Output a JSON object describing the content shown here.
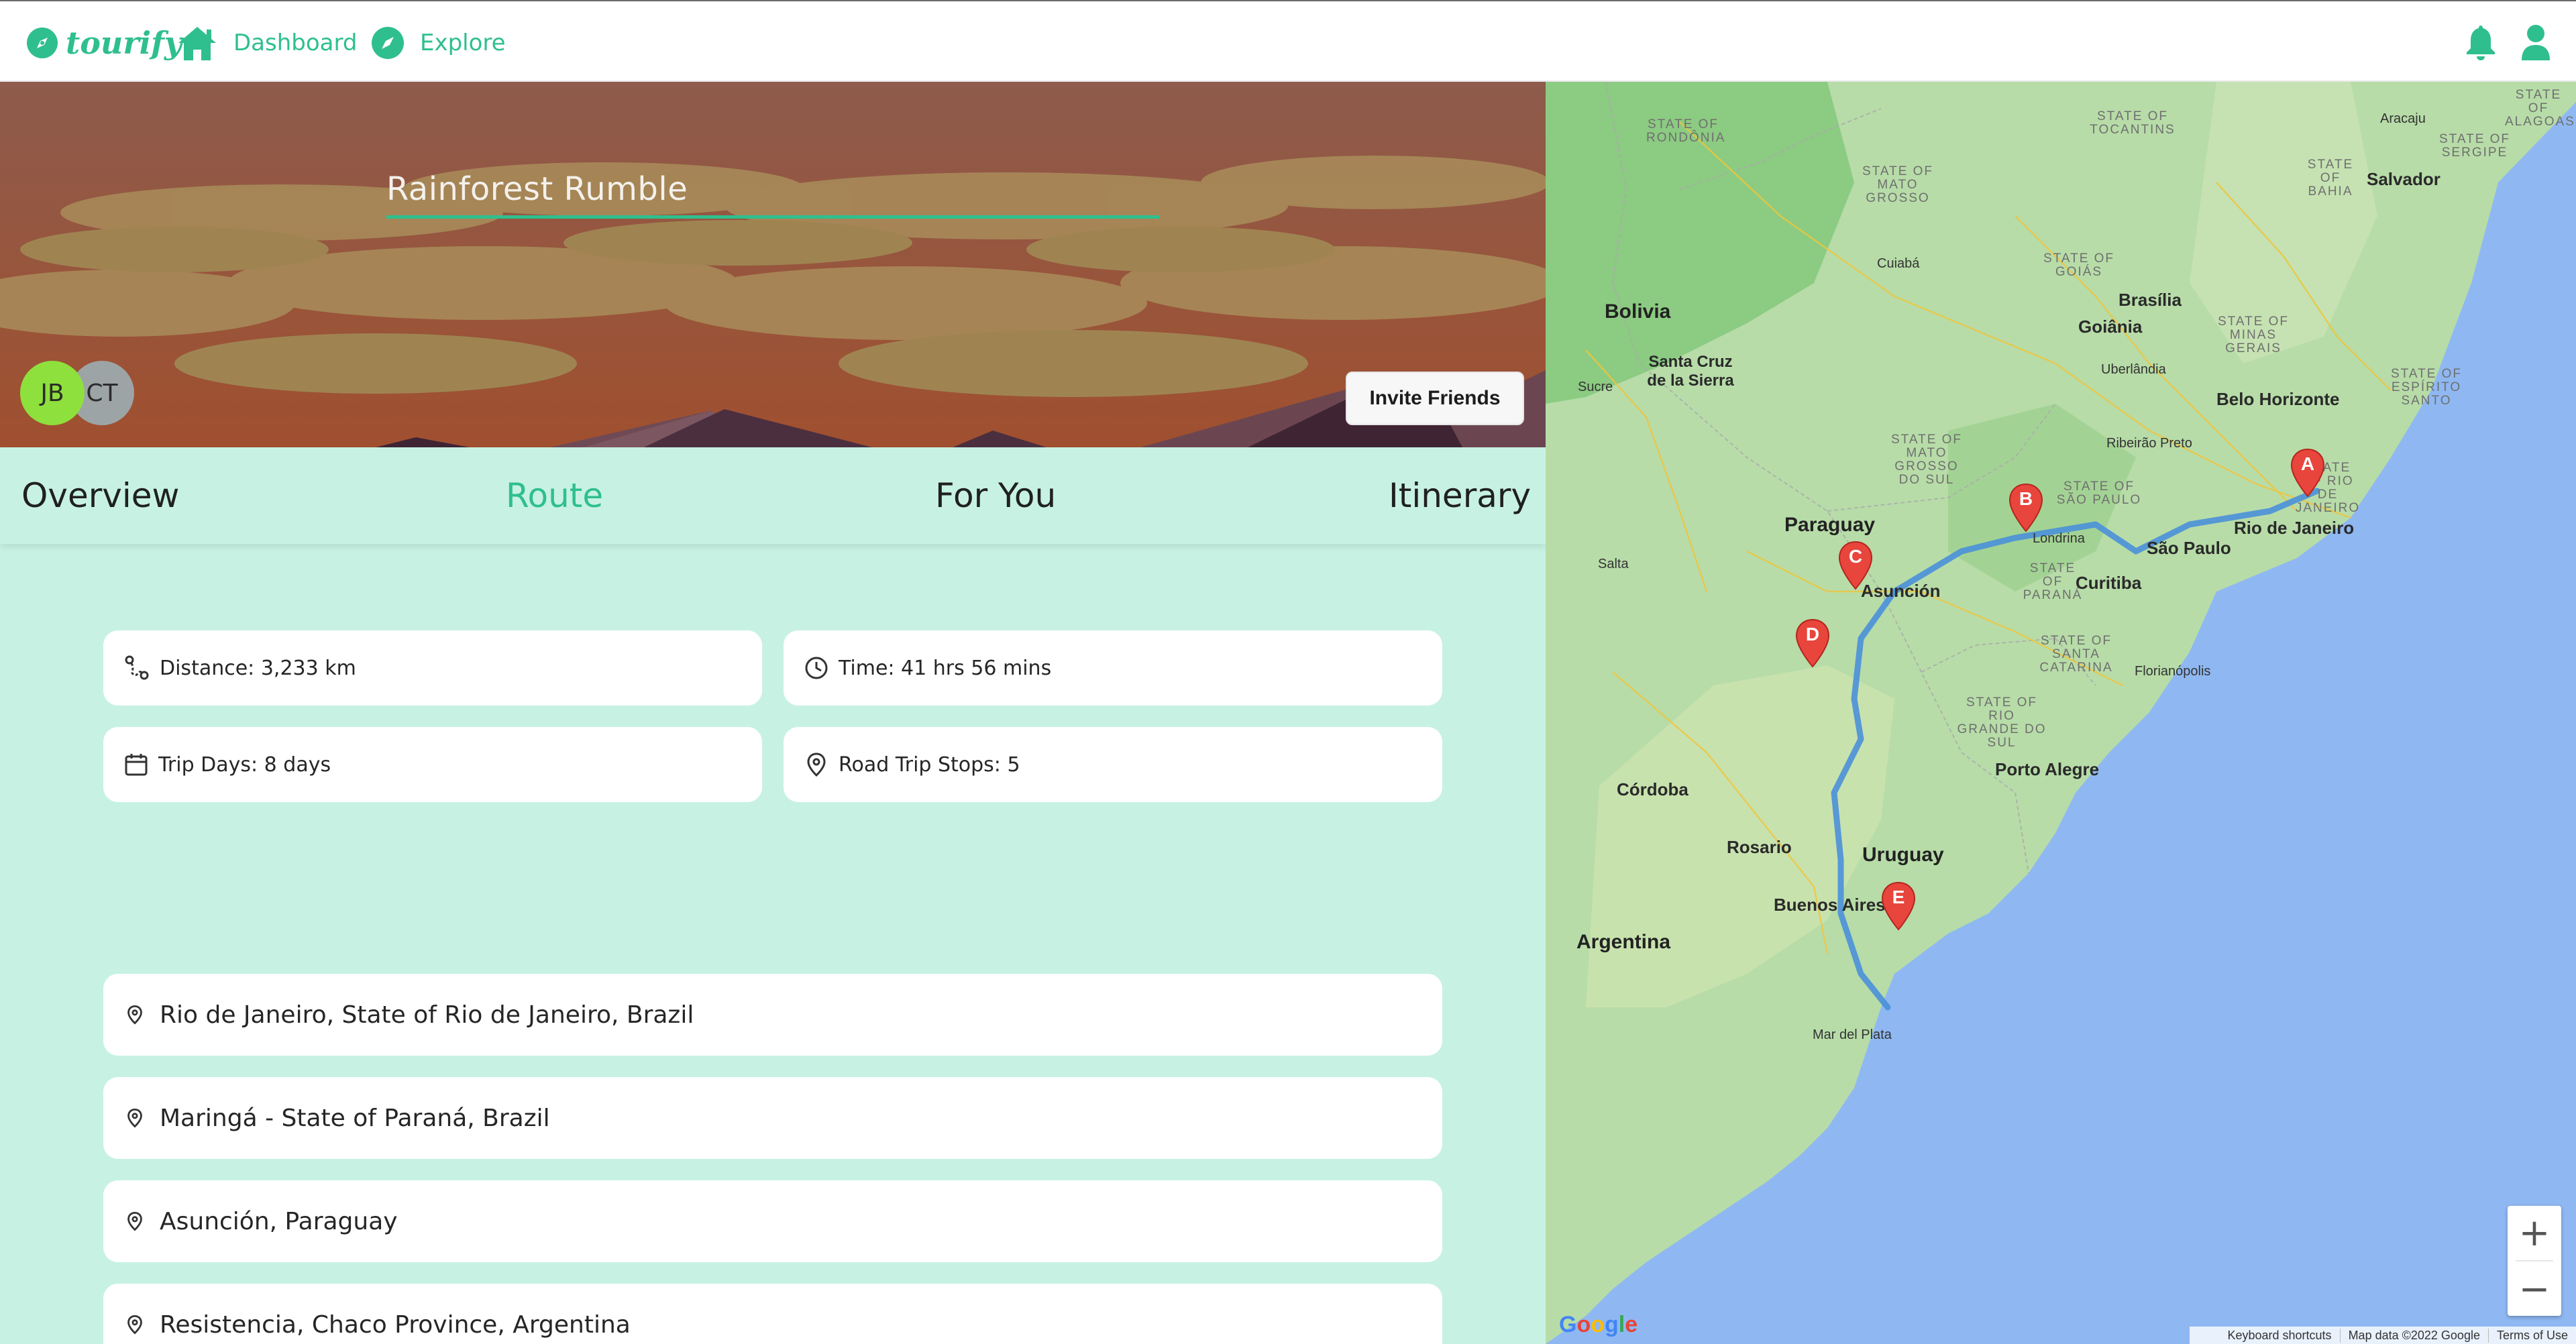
{
  "nav": {
    "brand": "tourify",
    "links": [
      {
        "label": "Dashboard",
        "icon": "home-icon"
      },
      {
        "label": "Explore",
        "icon": "compass-icon"
      }
    ],
    "right_icons": [
      "bell-icon",
      "user-icon"
    ]
  },
  "trip": {
    "title": "Rainforest Rumble",
    "members": [
      "JB",
      "CT"
    ],
    "invite_label": "Invite Friends"
  },
  "tabs": [
    {
      "label": "Overview",
      "active": false
    },
    {
      "label": "Route",
      "active": true
    },
    {
      "label": "For You",
      "active": false
    },
    {
      "label": "Itinerary",
      "active": false
    }
  ],
  "stats": {
    "distance": "Distance: 3,233 km",
    "time": "Time: 41 hrs 56 mins",
    "trip_days": "Trip Days: 8 days",
    "road_trip_stops": "Road Trip Stops: 5"
  },
  "stops": [
    "Rio de Janeiro, State of Rio de Janeiro, Brazil",
    "Maringá - State of Paraná, Brazil",
    "Asunción, Paraguay",
    "Resistencia, Chaco Province, Argentina"
  ],
  "map": {
    "markers": [
      "A",
      "B",
      "C",
      "D",
      "E"
    ],
    "countries": [
      "Bolivia",
      "Paraguay",
      "Uruguay",
      "Argentina"
    ],
    "cities": [
      "Brasília",
      "Goiânia",
      "Belo Horizonte",
      "Rio de Janeiro",
      "São Paulo",
      "Curitiba",
      "Porto Alegre",
      "Córdoba",
      "Rosario",
      "Buenos Aires",
      "Santa Cruz de la Sierra",
      "Salvador",
      "Asunción"
    ],
    "small_places": [
      "Cuiabá",
      "Sucre",
      "Salta",
      "Uberlândia",
      "Ribeirão Preto",
      "Londrina",
      "Florianópolis",
      "Mar del Plata",
      "Aracaju"
    ],
    "state_labels": [
      "STATE OF RONDÔNIA",
      "STATE OF MATO GROSSO",
      "STATE OF TOCANTINS",
      "STATE OF BAHIA",
      "STATE OF SERGIPE",
      "STATE OF GOIÁS",
      "STATE OF MINAS GERAIS",
      "STATE OF ESPÍRITO SANTO",
      "STATE OF MATO GROSSO DO SUL",
      "STATE OF SÃO PAULO",
      "STATE OF PARANÁ",
      "STATE OF SANTA CATARINA",
      "STATE OF RIO GRANDE DO SUL",
      "STATE OF RIO DE JANEIRO",
      "STATE OF ALAGOAS"
    ],
    "zoom_in": "+",
    "zoom_out": "−",
    "google": "Google",
    "attribution": [
      "Keyboard shortcuts",
      "Map data ©2022 Google",
      "Terms of Use"
    ]
  },
  "colors": {
    "accent": "#2fbf8e",
    "panel_bg": "#c7f2e3",
    "route": "#4a90d9",
    "marker": "#e8453c"
  }
}
